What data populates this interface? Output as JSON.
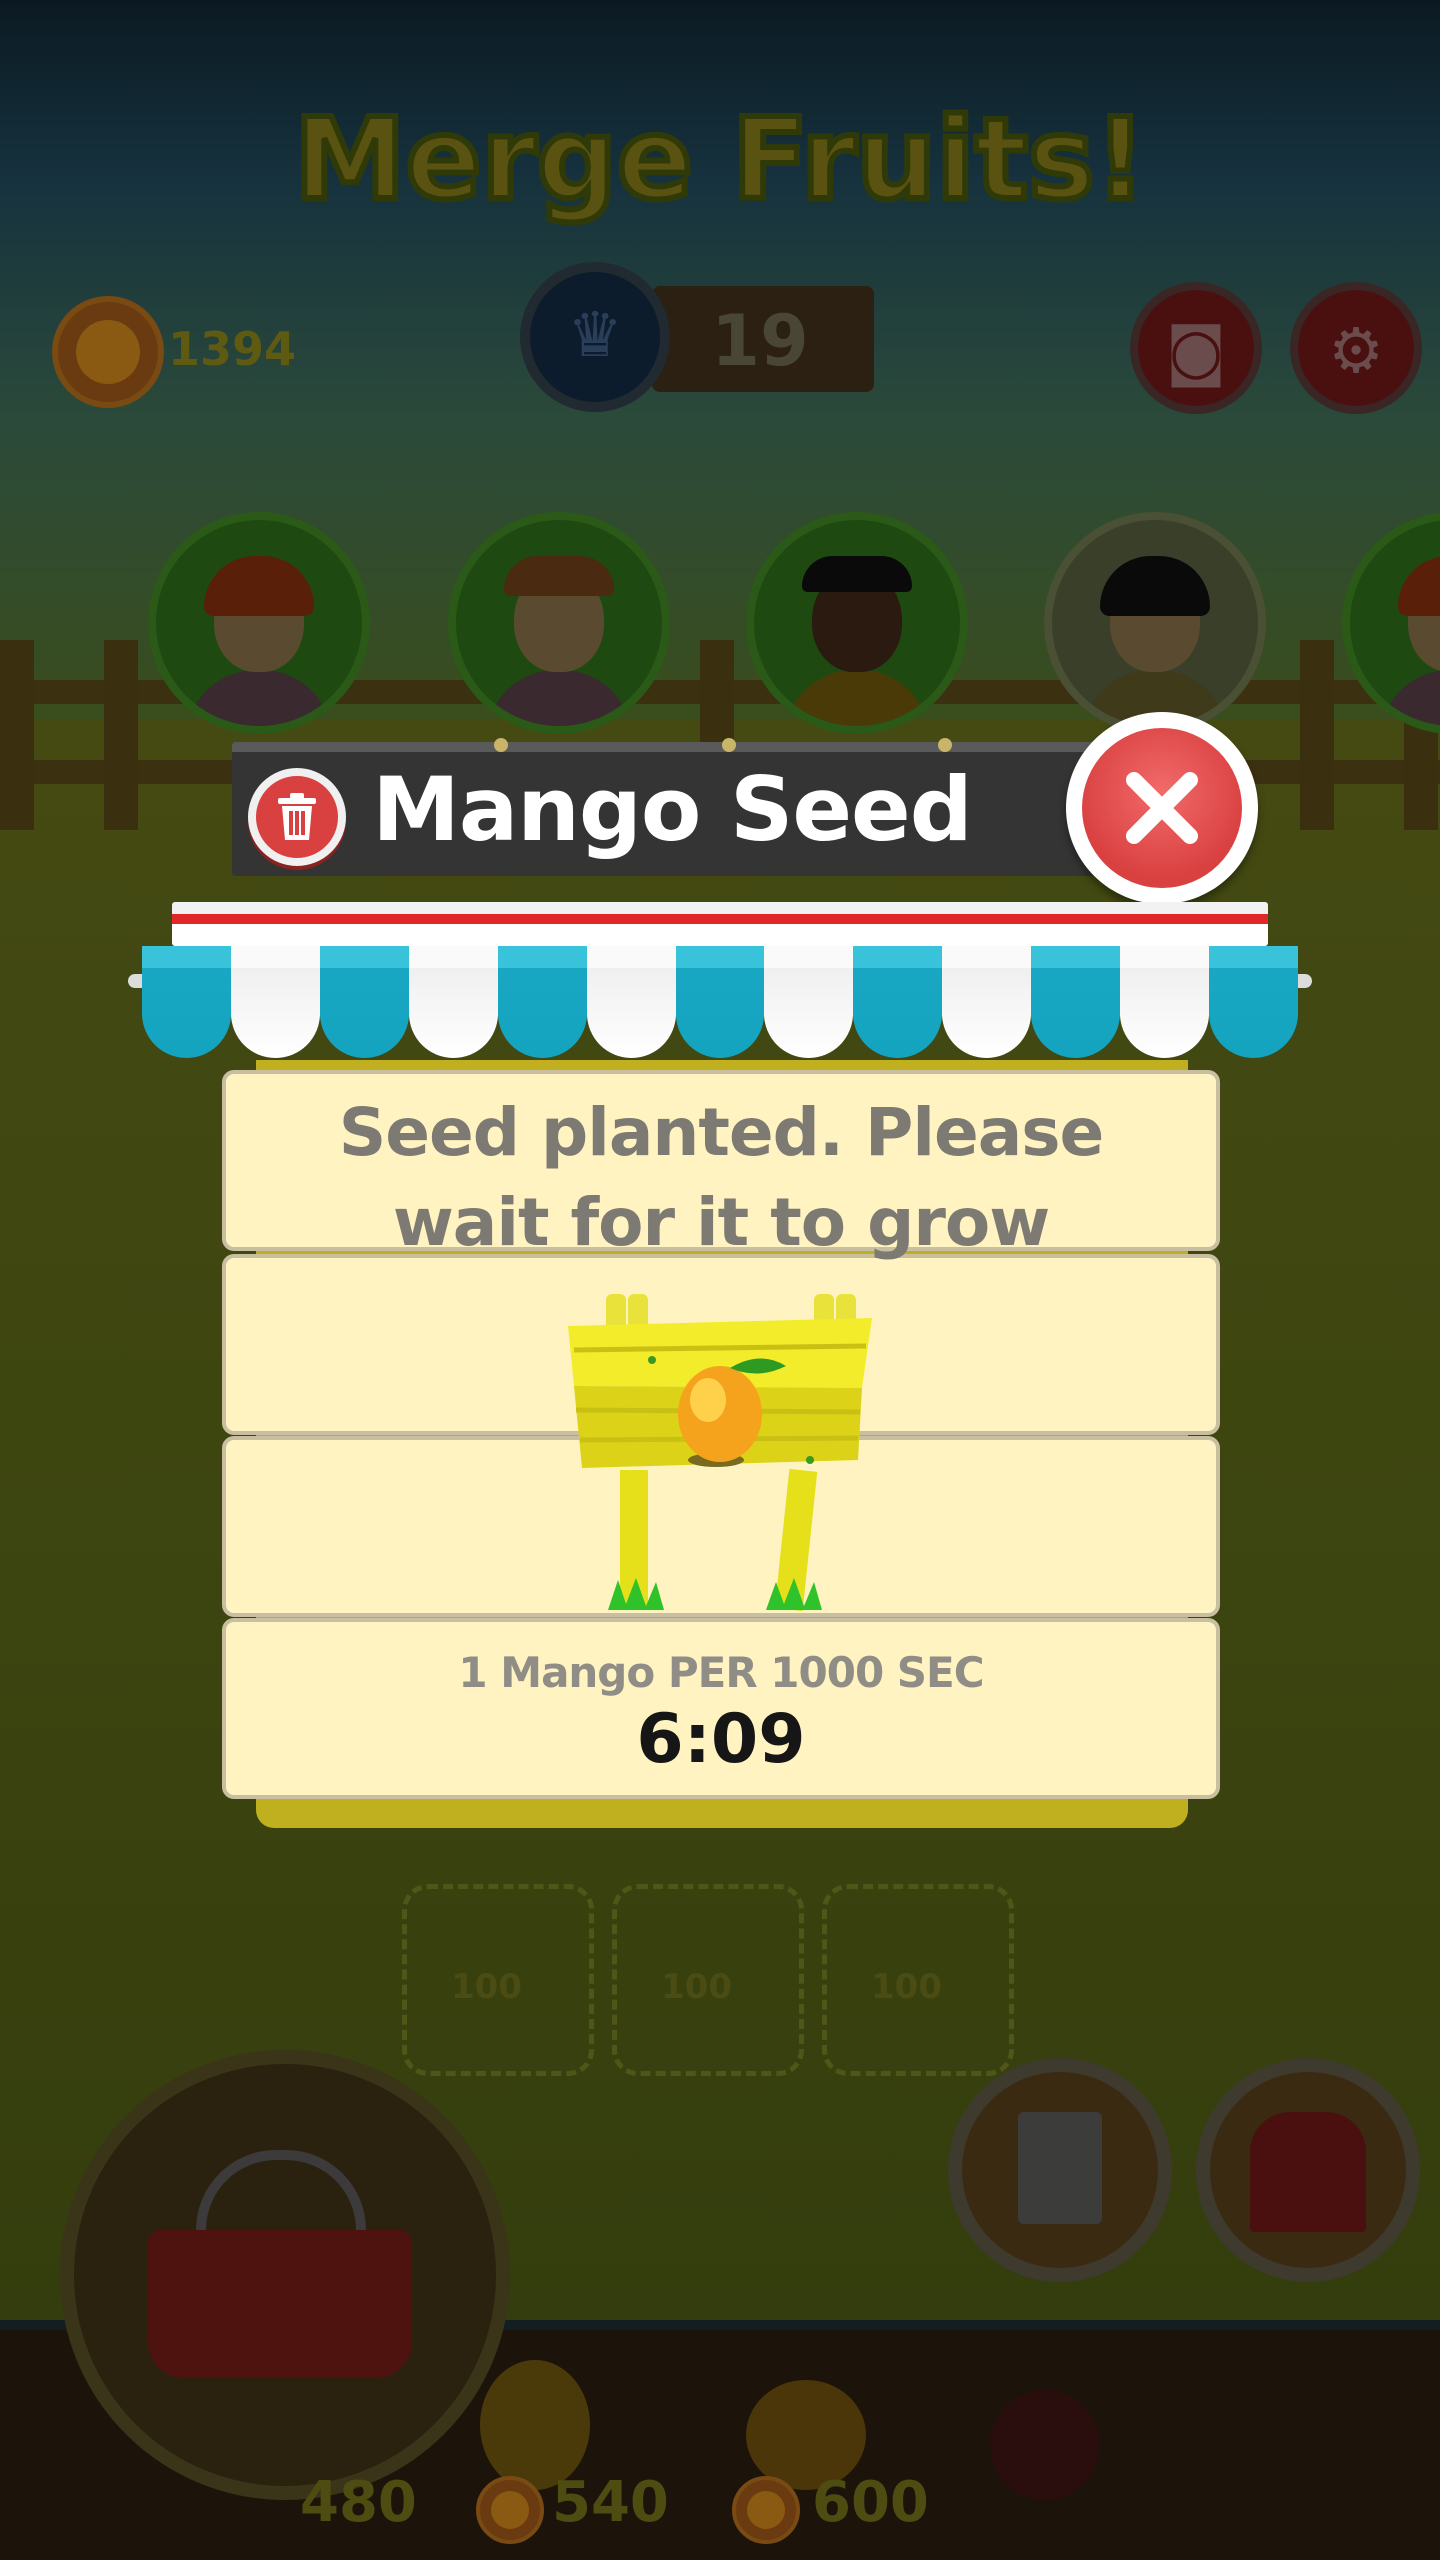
{
  "game": {
    "title": "Merge Fruits!",
    "coins": "1394",
    "level": "19"
  },
  "grid_slots": [
    {
      "cost": "100"
    },
    {
      "cost": "100"
    },
    {
      "cost": "100"
    }
  ],
  "shop_prices": [
    "480",
    "540",
    "600"
  ],
  "dialog": {
    "title": "Mango Seed",
    "message_line1": "Seed planted. Please",
    "message_line2": "wait for it to grow",
    "rate": "1 Mango PER 1000 SEC",
    "timer": "6:09"
  },
  "icons": {
    "trash": "trash-icon",
    "close": "close-icon",
    "camera": "camera-icon",
    "settings": "gear-icon",
    "crown": "crown-icon",
    "coin": "coin-icon",
    "basket": "basket-icon",
    "clipboard": "clipboard-icon",
    "shop": "shop-icon",
    "mango_sign": "mango-sign-icon"
  },
  "colors": {
    "close_red": "#d94040",
    "awning_blue": "#14a4c0",
    "panel_cream": "#fff3c1",
    "title_bar": "#343434"
  }
}
